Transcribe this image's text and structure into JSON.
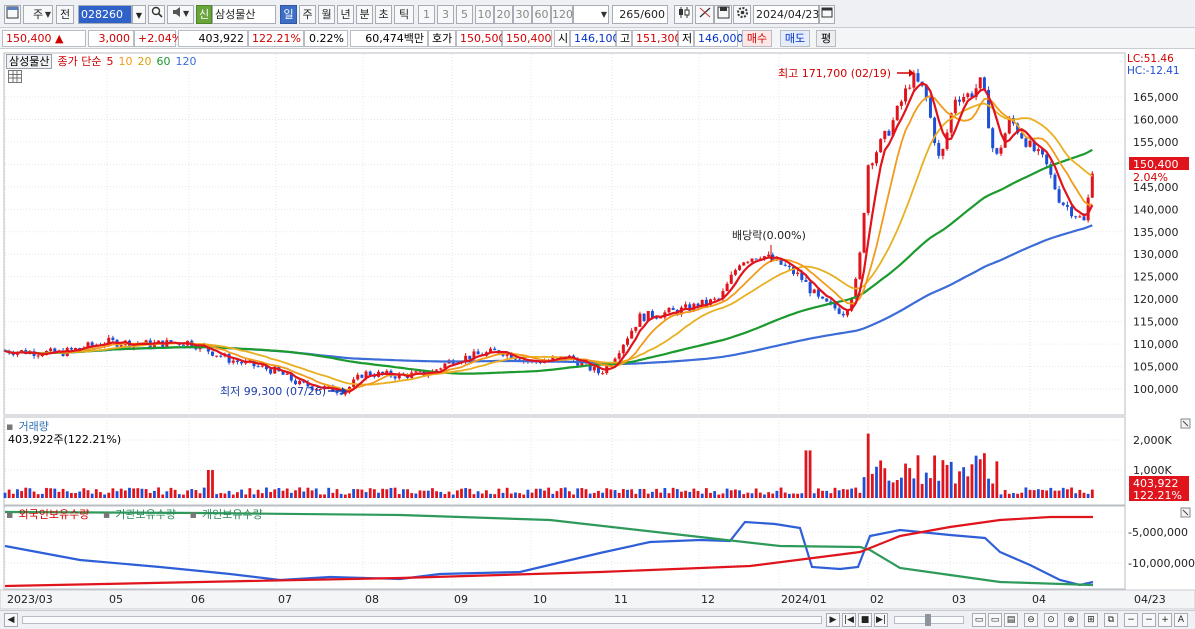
{
  "toolbar": {
    "period_unit": "주",
    "prev_label": "전",
    "code": "028260",
    "stock_badge": "신",
    "stock_name": "삼성물산",
    "period_tabs": [
      "일",
      "주",
      "월",
      "년",
      "분",
      "초",
      "틱"
    ],
    "selected_tab": "일",
    "minute_options": [
      "1",
      "3",
      "5",
      "10",
      "20",
      "30",
      "60",
      "120"
    ],
    "count": "265",
    "count_total": "/600",
    "date": "2024/04/23"
  },
  "quote": {
    "price": "150,400",
    "direction": "▲",
    "change": "3,000",
    "change_pct": "+2.04%",
    "volume": "403,922",
    "volume_ratio": "122.21%",
    "turnover": "0.22%",
    "amount": "60,474백만",
    "ask_label": "호가",
    "ask": "150,500",
    "bid": "150,400",
    "open_label": "시",
    "open": "146,100",
    "high_label": "고",
    "high": "151,300",
    "low_label": "저",
    "low": "146,000",
    "buy_label": "매수",
    "sell_label": "매도",
    "avg_label": "평"
  },
  "price_pane": {
    "legend_name": "삼성물산",
    "legend_title": "종가 단순",
    "ma_labels": [
      "5",
      "10",
      "20",
      "60",
      "120"
    ],
    "lc": "LC:51.46",
    "hc": "HC:-12.41",
    "high_note": "최고 171,700 (02/19)",
    "low_note": "최저 99,300 (07/26)",
    "dividend_note": "배당락(0.00%)",
    "current_price_tag": "150,400",
    "current_pct_tag": "2.04%",
    "y_ticks": [
      "165,000",
      "160,000",
      "155,000",
      "150,000",
      "145,000",
      "140,000",
      "135,000",
      "130,000",
      "125,000",
      "120,000",
      "115,000",
      "110,000",
      "105,000",
      "100,000"
    ]
  },
  "volume_pane": {
    "title": "거래량",
    "value": "403,922주(122.21%)",
    "y_ticks": [
      "2,000K",
      "1,000K"
    ],
    "current_tag": "403,922",
    "current_pct_tag": "122.21%"
  },
  "holdings_pane": {
    "legend": [
      "외국인보유수량",
      "기관보유수량",
      "개인보유수량"
    ],
    "y_ticks": [
      "-5,000,000",
      "-10,000,000"
    ]
  },
  "x_axis": {
    "labels": [
      "2023/03",
      "05",
      "06",
      "07",
      "08",
      "09",
      "10",
      "11",
      "12",
      "2024/01",
      "02",
      "03",
      "04"
    ],
    "last_label": "04/23"
  },
  "colors": {
    "up": "#e0141c",
    "down": "#1f4fd6",
    "ma5": "#e0141c",
    "ma10": "#f29a1b",
    "ma20": "#e8b020",
    "ma60": "#1b9a2e",
    "ma120": "#3c6cd8",
    "foreign": "#2f5fd8",
    "institution": "#2e9a5a",
    "individual": "#e0141c"
  },
  "icons": [
    "window-icon",
    "search-icon",
    "speaker-icon",
    "candle-icon",
    "cross-icon",
    "save-icon",
    "gear-icon",
    "calendar-icon",
    "grid-icon"
  ]
}
